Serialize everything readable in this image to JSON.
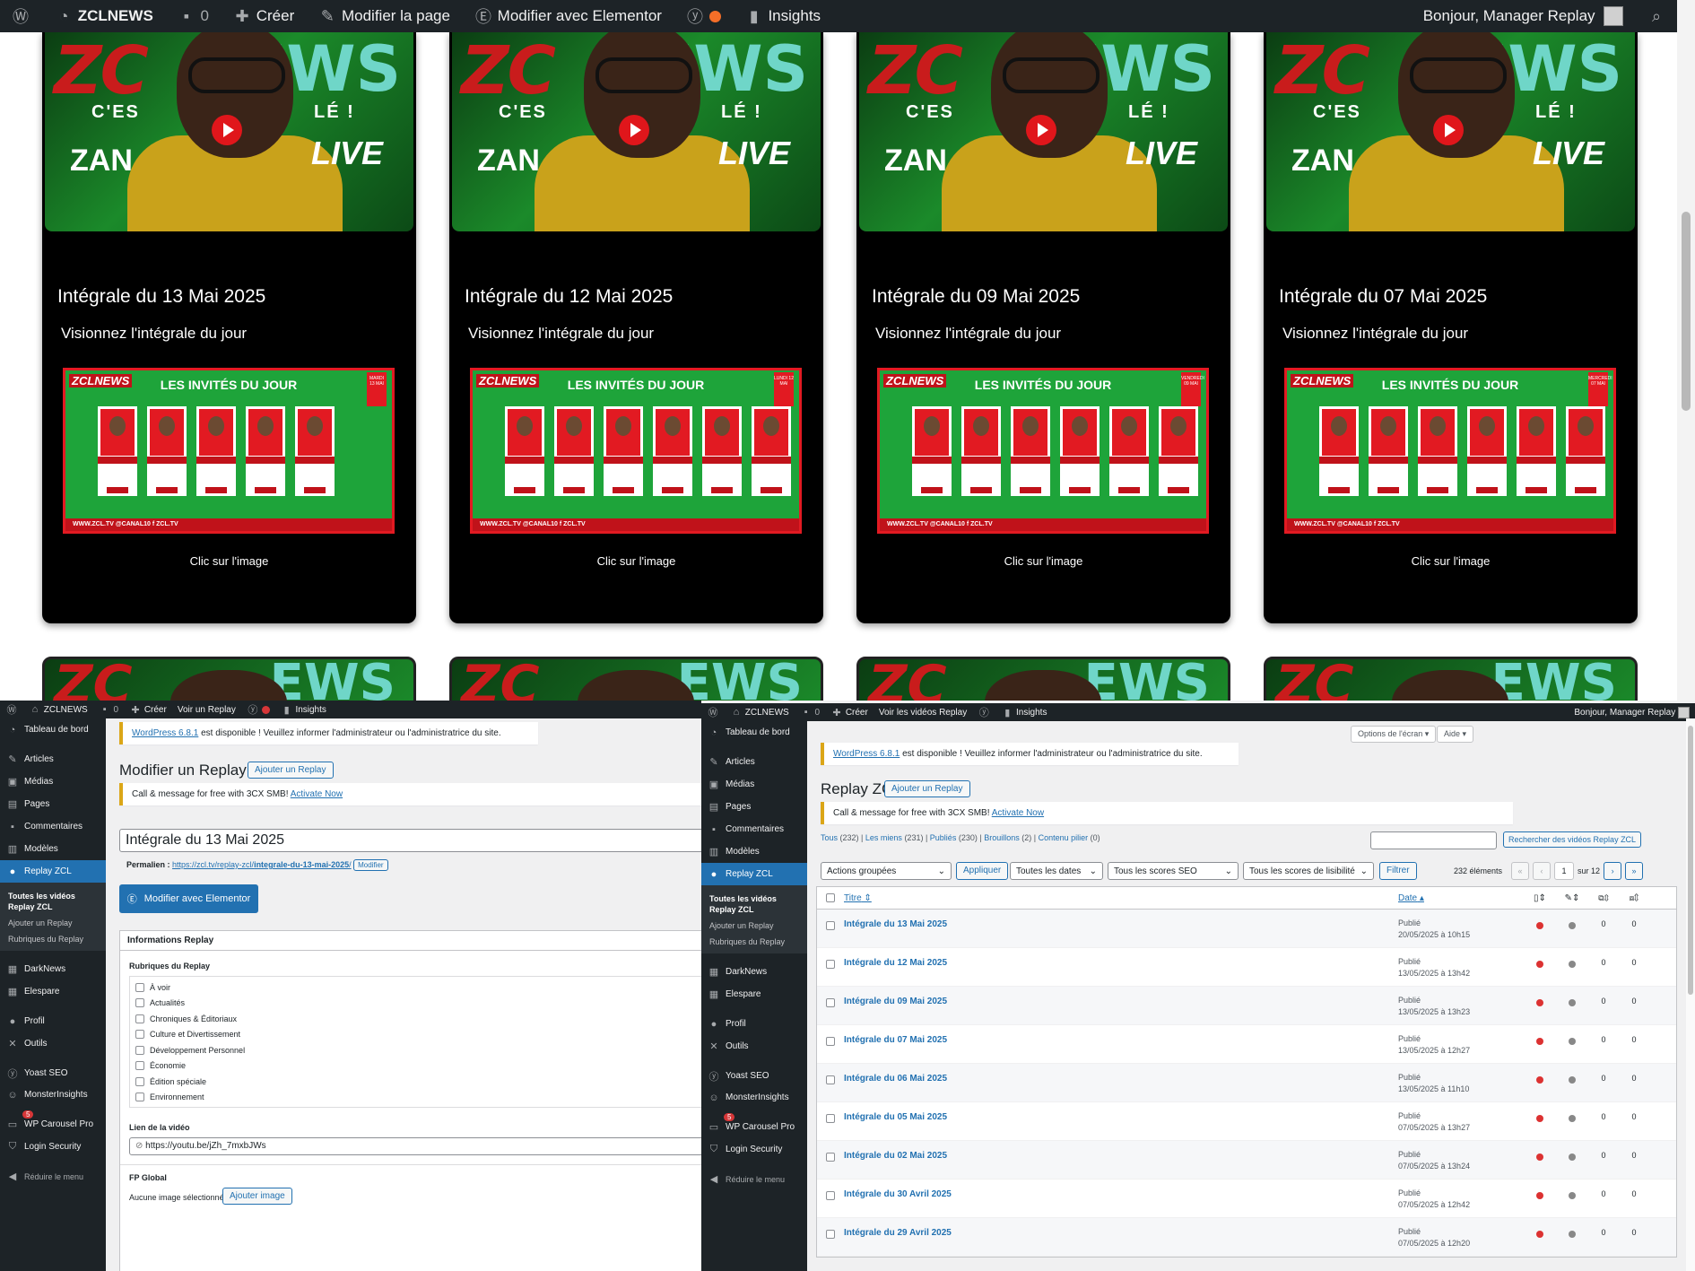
{
  "top_bar": {
    "site": "ZCLNEWS",
    "comments": "0",
    "create": "Créer",
    "edit_page": "Modifier la page",
    "edit_elementor": "Modifier avec Elementor",
    "insights": "Insights",
    "greeting": "Bonjour, Manager Replay"
  },
  "thumbnail_text": {
    "logo_left": "ZC",
    "logo_right": "EWS",
    "slogan": "C'ES",
    "slogan2": "LÉ !",
    "zan": "ZAN",
    "live": "LIVE"
  },
  "poster": {
    "logo": "ZCLNEWS",
    "heading": "LES INVITÉS DU JOUR",
    "footer": "WWW.ZCL.TV    @CANAL10    f ZCL.TV"
  },
  "cards": [
    {
      "title": "Intégrale du 13 Mai 2025",
      "subtitle": "Visionnez l'intégrale du jour",
      "footer": "Clic sur l'image",
      "date_tag": "MARDI 13 MAI"
    },
    {
      "title": "Intégrale du 12 Mai 2025",
      "subtitle": "Visionnez l'intégrale du jour",
      "footer": "Clic sur l'image",
      "date_tag": "LUNDI 12 MAI"
    },
    {
      "title": "Intégrale du 09 Mai 2025",
      "subtitle": "Visionnez l'intégrale du jour",
      "footer": "Clic sur l'image",
      "date_tag": "VENDREDI 09 MAI"
    },
    {
      "title": "Intégrale du 07 Mai 2025",
      "subtitle": "Visionnez l'intégrale du jour",
      "footer": "Clic sur l'image",
      "date_tag": "MERCREDI 07 MAI"
    }
  ],
  "admin_menu": {
    "dashboard": "Tableau de bord",
    "posts": "Articles",
    "media": "Médias",
    "pages": "Pages",
    "comments": "Commentaires",
    "templates": "Modèles",
    "replay": "Replay ZCL",
    "replay_sub": [
      "Toutes les vidéos Replay ZCL",
      "Ajouter un Replay",
      "Rubriques du Replay"
    ],
    "darknews": "DarkNews",
    "elespare": "Elespare",
    "profile": "Profil",
    "tools": "Outils",
    "yoast": "Yoast SEO",
    "monsterinsights": "MonsterInsights",
    "monster_badge": "5",
    "carousel": "WP Carousel Pro",
    "login_security": "Login Security",
    "collapse": "Réduire le menu"
  },
  "left_window": {
    "bar_site": "ZCLNEWS",
    "bar_comments": "0",
    "bar_create": "Créer",
    "bar_view": "Voir un Replay",
    "bar_insights": "Insights",
    "notice_link": "WordPress 6.8.1",
    "notice_text": " est disponible ! Veuillez informer l'administrateur ou l'administratrice du site.",
    "heading": "Modifier un Replay",
    "add_button": "Ajouter un Replay",
    "notice2_text": "Call & message for free with 3CX SMB! ",
    "notice2_link": "Activate Now",
    "post_title": "Intégrale du 13 Mai 2025",
    "permalink_label": "Permalien : ",
    "permalink_base": "https://zcl.tv/replay-zcl/",
    "permalink_slug": "integrale-du-13-mai-2025",
    "permalink_end": "/",
    "permalink_edit": "Modifier",
    "elementor_button": "Modifier avec Elementor",
    "info_title": "Informations Replay",
    "rubriques_title": "Rubriques du Replay",
    "categories": [
      "À voir",
      "Actualités",
      "Chroniques & Éditoriaux",
      "Culture et Divertissement",
      "Développement Personnel",
      "Économie",
      "Édition spéciale",
      "Environnement"
    ],
    "video_label": "Lien de la vidéo",
    "video_value": "https://youtu.be/jZh_7mxbJWs",
    "fp_label": "FP Global",
    "image_text": "Aucune image sélectionnée",
    "image_button": "Ajouter image"
  },
  "right_window": {
    "bar_site": "ZCLNEWS",
    "bar_comments": "0",
    "bar_create": "Créer",
    "bar_view": "Voir les vidéos Replay",
    "bar_insights": "Insights",
    "bar_greeting": "Bonjour, Manager Replay",
    "screen_options": "Options de l'écran ▾",
    "help": "Aide ▾",
    "notice_link": "WordPress 6.8.1",
    "notice_text": " est disponible ! Veuillez informer l'administrateur ou l'administratrice du site.",
    "heading": "Replay ZCL",
    "add_button": "Ajouter un Replay",
    "notice2_text": "Call & message for free with 3CX SMB! ",
    "notice2_link": "Activate Now",
    "filters": {
      "all": "Tous",
      "all_count": "(232)",
      "mine": "Les miens",
      "mine_count": "(231)",
      "published": "Publiés",
      "published_count": "(230)",
      "drafts": "Brouillons",
      "drafts_count": "(2)",
      "sticky": "Contenu pilier",
      "sticky_count": "(0)"
    },
    "search_button": "Rechercher des vidéos Replay ZCL",
    "bulk_actions": "Actions groupées",
    "apply": "Appliquer",
    "dates": "Toutes les dates",
    "seo_scores": "Tous les scores SEO",
    "readability": "Tous les scores de lisibilité",
    "filter": "Filtrer",
    "items_count": "232 éléments",
    "page_current": "1",
    "page_total": "sur 12",
    "col_title": "Titre",
    "col_date": "Date",
    "rows": [
      {
        "title": "Intégrale du 13 Mai 2025",
        "status": "Publié",
        "date": "20/05/2025 à 10h15",
        "c1": "0",
        "c2": "0"
      },
      {
        "title": "Intégrale du 12 Mai 2025",
        "status": "Publié",
        "date": "13/05/2025 à 13h42",
        "c1": "0",
        "c2": "0"
      },
      {
        "title": "Intégrale du 09 Mai 2025",
        "status": "Publié",
        "date": "13/05/2025 à 13h23",
        "c1": "0",
        "c2": "0"
      },
      {
        "title": "Intégrale du 07 Mai 2025",
        "status": "Publié",
        "date": "13/05/2025 à 12h27",
        "c1": "0",
        "c2": "0"
      },
      {
        "title": "Intégrale du 06 Mai 2025",
        "status": "Publié",
        "date": "13/05/2025 à 11h10",
        "c1": "0",
        "c2": "0"
      },
      {
        "title": "Intégrale du 05 Mai 2025",
        "status": "Publié",
        "date": "07/05/2025 à 13h27",
        "c1": "0",
        "c2": "0"
      },
      {
        "title": "Intégrale du 02 Mai 2025",
        "status": "Publié",
        "date": "07/05/2025 à 13h24",
        "c1": "0",
        "c2": "0"
      },
      {
        "title": "Intégrale du 30 Avril 2025",
        "status": "Publié",
        "date": "07/05/2025 à 12h42",
        "c1": "0",
        "c2": "0"
      },
      {
        "title": "Intégrale du 29 Avril 2025",
        "status": "Publié",
        "date": "07/05/2025 à 12h20",
        "c1": "0",
        "c2": "0"
      }
    ]
  },
  "icons": [
    "wordpress-icon",
    "speedometer-icon",
    "comment-icon",
    "plus-icon",
    "pencil-icon",
    "elementor-icon",
    "yoast-icon",
    "insights-icon",
    "search-icon",
    "pin-icon",
    "media-icon",
    "page-icon",
    "brush-icon",
    "shield-icon",
    "lock-icon"
  ],
  "colors": {
    "admin_bar": "#1d2327",
    "wp_blue": "#2271b1",
    "poster_green": "#1ea43a",
    "poster_red": "#e21a22",
    "seo_red": "#dc3232"
  }
}
